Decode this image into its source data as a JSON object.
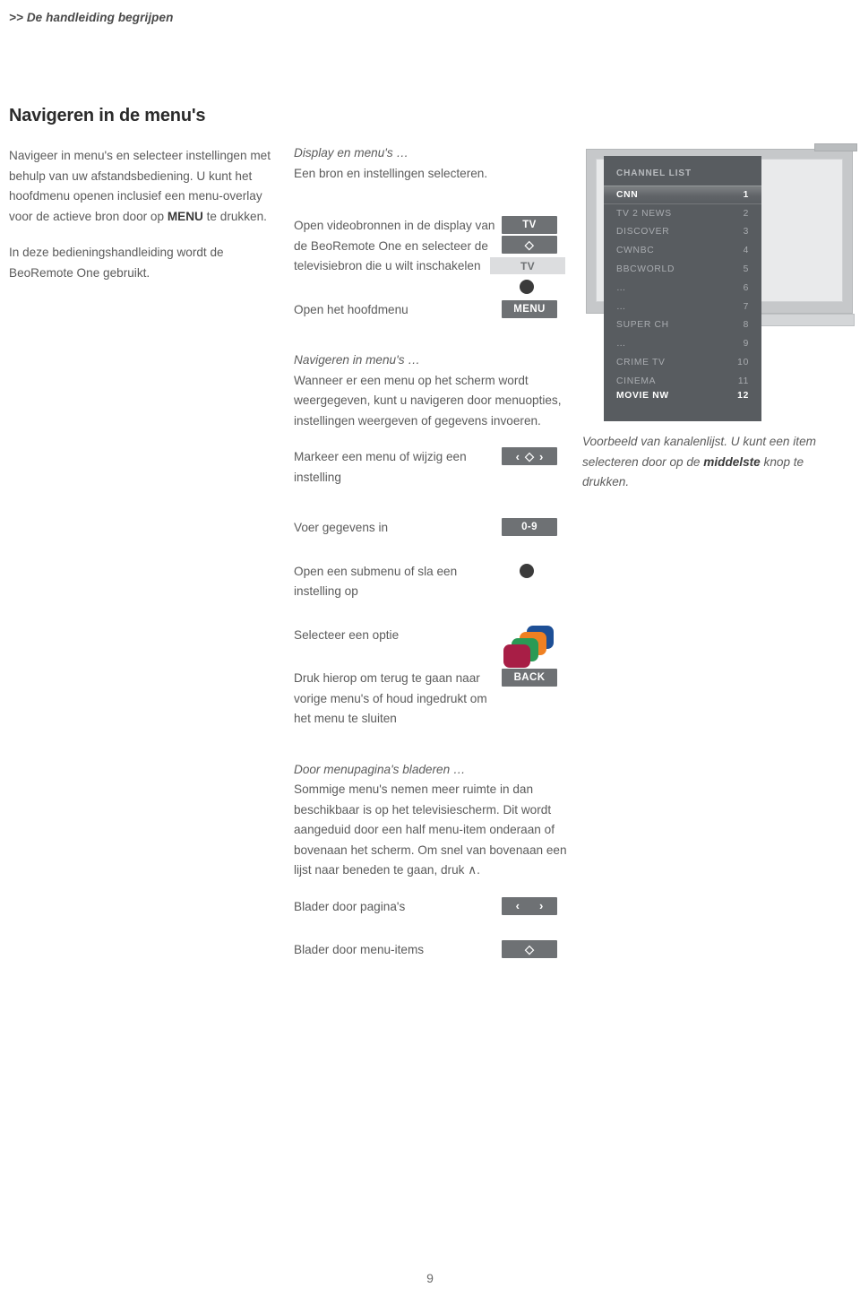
{
  "running_header": ">> De handleiding begrijpen",
  "page_number": "9",
  "left_column": {
    "title": "Navigeren in de menu's",
    "paragraph_1_part_1": "Navigeer in menu's en selecteer instellingen met behulp van uw afstandsbediening. U kunt het hoofdmenu openen inclusief een menu-overlay voor de actieve bron door op ",
    "paragraph_1_bold": "MENU",
    "paragraph_1_part_2": " te drukken.",
    "paragraph_2": "In deze bedieningshandleiding wordt de BeoRemote One gebruikt."
  },
  "middle_column": {
    "section_display": {
      "heading": "Display en menu's …",
      "intro": "Een bron en instellingen selecteren.",
      "rows": [
        {
          "text": "Open videobronnen in de display van de BeoRemote One en selecteer de televisiebron die u wilt inschakelen",
          "key_tv_label": "TV",
          "key_nav_glyph": "◇",
          "display_label": "TV",
          "center_button": "center-dot"
        },
        {
          "text": "Open het hoofdmenu",
          "key_label": "MENU"
        }
      ]
    },
    "section_navigate": {
      "heading": "Navigeren in menu's …",
      "intro": "Wanneer er een menu op het scherm wordt weergegeven, kunt u navigeren door menuopties, instellingen weergeven of gegevens invoeren.",
      "rows": [
        {
          "text": "Markeer een menu of wijzig een instelling",
          "key_left": "‹",
          "key_center": "◇",
          "key_right": "›"
        },
        {
          "text": "Voer gegevens in",
          "key_label": "0-9"
        },
        {
          "text": "Open een submenu of sla een instelling op",
          "center_button": "center-dot"
        },
        {
          "text": "Selecteer een optie",
          "color_keys": [
            "#1d4f96",
            "#ef8022",
            "#2a9a55",
            "#a81e46"
          ]
        },
        {
          "text": "Druk hierop om terug te gaan naar vorige menu's of houd ingedrukt om het menu te sluiten",
          "key_label": "BACK"
        }
      ]
    },
    "section_paging": {
      "heading": "Door menupagina's bladeren …",
      "intro": "Sommige menu's nemen meer ruimte in dan beschikbaar is op het televisiescherm. Dit wordt aangeduid door een half menu-item onderaan of bovenaan het scherm. Om snel van bovenaan een lijst naar beneden te gaan, druk ∧.",
      "rows": [
        {
          "text": "Blader door pagina's",
          "key_left": "‹",
          "key_right": "›"
        },
        {
          "text": "Blader door menu-items",
          "key_center": "◇"
        }
      ]
    }
  },
  "right_column": {
    "tv_figure": {
      "channel_list": {
        "title": "CHANNEL LIST",
        "items": [
          {
            "name": "CNN",
            "number": "1",
            "state": "selected"
          },
          {
            "name": "TV 2 NEWS",
            "number": "2",
            "state": "normal"
          },
          {
            "name": "DISCOVER",
            "number": "3",
            "state": "normal"
          },
          {
            "name": "CWNBC",
            "number": "4",
            "state": "normal"
          },
          {
            "name": "BBCWORLD",
            "number": "5",
            "state": "normal"
          },
          {
            "name": "…",
            "number": "6",
            "state": "normal"
          },
          {
            "name": "…",
            "number": "7",
            "state": "normal"
          },
          {
            "name": "SUPER CH",
            "number": "8",
            "state": "normal"
          },
          {
            "name": "…",
            "number": "9",
            "state": "normal"
          },
          {
            "name": "CRIME TV",
            "number": "10",
            "state": "normal"
          },
          {
            "name": "CINEMA",
            "number": "11",
            "state": "normal"
          },
          {
            "name": "MOVIE NW",
            "number": "12",
            "state": "half"
          }
        ]
      }
    },
    "caption_part_1": "Voorbeeld van kanalenlijst. U kunt een item selecteren door op de ",
    "caption_bold": "middelste",
    "caption_part_2": " knop te drukken."
  }
}
